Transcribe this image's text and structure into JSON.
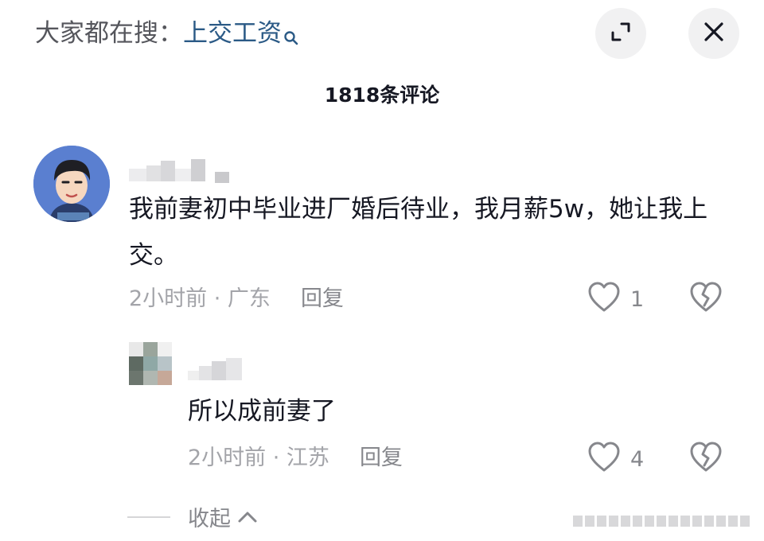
{
  "header": {
    "search_prefix": "大家都在搜：",
    "search_keyword": "上交工资",
    "comment_count": "1818条评论"
  },
  "comments": [
    {
      "text": "我前妻初中毕业进厂婚后待业，我月薪5w，她让我上交。",
      "time_location": "2小时前 · 广东",
      "reply_label": "回复",
      "likes": "1"
    },
    {
      "text": "所以成前妻了",
      "time_location": "2小时前 · 江苏",
      "reply_label": "回复",
      "likes": "4"
    }
  ],
  "collapse_label": "收起",
  "icons": {
    "search": "search-icon",
    "expand": "expand-icon",
    "close": "close-icon",
    "like": "heart-outline-icon",
    "dislike": "broken-heart-icon",
    "collapse": "chevron-up-icon"
  },
  "colors": {
    "keyword": "#2b5a86",
    "meta": "#a3a4a9",
    "avatar_bg": "#5a7fd0"
  }
}
